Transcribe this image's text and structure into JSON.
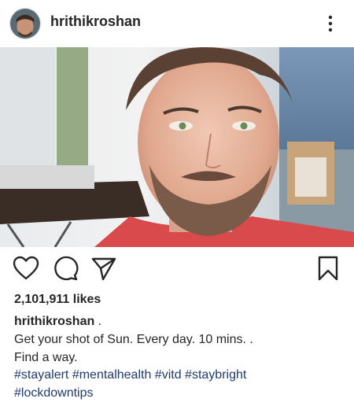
{
  "post": {
    "username": "hrithikroshan",
    "likes": "2,101,911 likes",
    "caption_user": "hrithikroshan",
    "caption_line1": " .",
    "caption_line2": "Get your shot of Sun. Every day. 10 mins. .",
    "caption_line3": "Find a way.",
    "hashtags": [
      "#stayalert",
      "#mentalhealth",
      "#vitd",
      "#staybright",
      "#lockdowntips"
    ]
  },
  "icons": {
    "more": "more-options-icon",
    "like": "heart-icon",
    "comment": "comment-icon",
    "share": "send-icon",
    "save": "bookmark-icon"
  },
  "colors": {
    "text": "#262626",
    "hashtag": "#1f3b6d",
    "icon": "#262626"
  }
}
